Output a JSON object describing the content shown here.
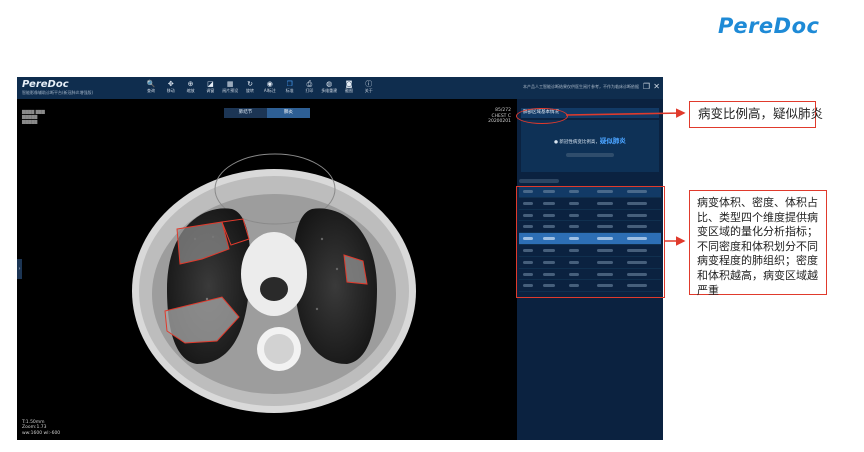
{
  "brand": {
    "logo_text": "PereDoc"
  },
  "app": {
    "logo": "PereDoc",
    "subtitle": "智能影像辅助诊断平台(新冠肺炎增强版)",
    "tools": [
      {
        "icon": "search-icon",
        "glyph": "🔍",
        "label": "查询"
      },
      {
        "icon": "move-icon",
        "glyph": "✥",
        "label": "移动"
      },
      {
        "icon": "zoom-icon",
        "glyph": "⊕",
        "label": "缩放"
      },
      {
        "icon": "window-icon",
        "glyph": "◪",
        "label": "调窗"
      },
      {
        "icon": "layout-icon",
        "glyph": "▦",
        "label": "阅片预设"
      },
      {
        "icon": "rotate-icon",
        "glyph": "↻",
        "label": "旋转"
      },
      {
        "icon": "eye-icon",
        "glyph": "◉",
        "label": "AI标注"
      },
      {
        "icon": "copy-icon",
        "glyph": "❐",
        "label": "标准"
      },
      {
        "icon": "print-icon",
        "glyph": "⎙",
        "label": "打印"
      },
      {
        "icon": "globe-icon",
        "glyph": "◍",
        "label": "多维重建"
      },
      {
        "icon": "camera-icon",
        "glyph": "◙",
        "label": "截图"
      },
      {
        "icon": "info-icon",
        "glyph": "ⓘ",
        "label": "关于"
      }
    ],
    "notice": "本产品人工智能诊断结果仅供医生阅片参考，不作为临床诊断依据",
    "window_buttons": [
      "❐",
      "✕"
    ]
  },
  "viewer": {
    "tabs": [
      {
        "label": "肺结节",
        "active": false
      },
      {
        "label": "肺炎",
        "active": true
      }
    ],
    "top_right": [
      "85/272",
      "CHEST C",
      "20200201"
    ],
    "bottom_left": [
      "T:1.50mm",
      "Zoom:1.73",
      "ww:1600 wl:-600"
    ]
  },
  "panel": {
    "header": "肺部区域基本情况",
    "result_prefix": "● 新冠性病变比例高，",
    "result_highlight": "疑似肺炎",
    "table_rows": 8,
    "selected_row": 4
  },
  "callouts": {
    "top": "病变比例高，疑似肺炎",
    "bottom": "病变体积、密度、体积占比、类型四个维度提供病变区域的量化分析指标；不同密度和体积划分不同病变程度的肺组织；密度和体积越高，病变区域越严重"
  },
  "colors": {
    "accent": "#1e8ad6",
    "annotation": "#e03a2c",
    "toolbar": "#0f2d4e",
    "highlight": "#4aa3ff"
  }
}
